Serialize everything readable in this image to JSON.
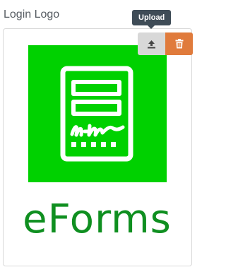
{
  "field": {
    "label": "Login Logo"
  },
  "logo": {
    "brand_text": "eForms",
    "background_color": "#00d100",
    "icon_color": "#ffffff",
    "brand_text_color": "#0f8f20"
  },
  "actions": {
    "upload_tooltip": "Upload",
    "upload_icon": "upload-icon",
    "delete_icon": "trash-icon",
    "upload_color": "#d8d8d8",
    "delete_color": "#e07b3c"
  }
}
